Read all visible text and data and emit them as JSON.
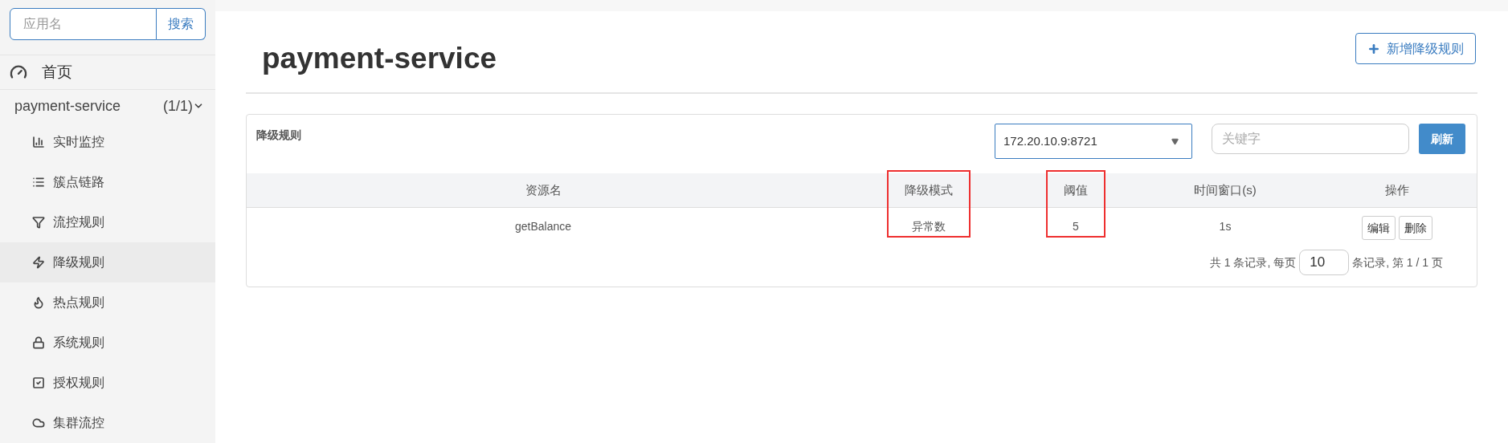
{
  "sidebar": {
    "search": {
      "placeholder": "应用名",
      "button": "搜索"
    },
    "home": {
      "label": "首页"
    },
    "app": {
      "name": "payment-service",
      "count": "(1/1)",
      "expanded": true,
      "items": [
        {
          "kind": "monitor",
          "label": "实时监控",
          "selected": false
        },
        {
          "kind": "list",
          "label": "簇点链路",
          "selected": false
        },
        {
          "kind": "filter",
          "label": "流控规则",
          "selected": false
        },
        {
          "kind": "bolt",
          "label": "降级规则",
          "selected": true
        },
        {
          "kind": "fire",
          "label": "热点规则",
          "selected": false
        },
        {
          "kind": "lock",
          "label": "系统规则",
          "selected": false
        },
        {
          "kind": "check",
          "label": "授权规则",
          "selected": false
        },
        {
          "kind": "cloud",
          "label": "集群流控",
          "selected": false
        }
      ]
    }
  },
  "page": {
    "title": "payment-service",
    "add_button": "新增降级规则"
  },
  "panel": {
    "title": "降级规则",
    "machine": "172.20.10.9:8721",
    "keyword": {
      "placeholder": "关键字"
    },
    "refresh": "刷新",
    "table": {
      "columns": [
        {
          "label": "资源名",
          "highlighted": false
        },
        {
          "label": "降级模式",
          "highlighted": true
        },
        {
          "label": "阈值",
          "highlighted": true
        },
        {
          "label": "时间窗口(s)",
          "highlighted": false
        },
        {
          "label": "操作",
          "highlighted": false
        }
      ],
      "rows": [
        {
          "cells": [
            "getBalance",
            "异常数",
            "5",
            "1s"
          ],
          "actions": [
            "编辑",
            "删除"
          ]
        }
      ]
    },
    "pagination": {
      "before": "共 1 条记录, 每页",
      "page_size": "10",
      "after": "条记录, 第 1 / 1 页"
    }
  }
}
